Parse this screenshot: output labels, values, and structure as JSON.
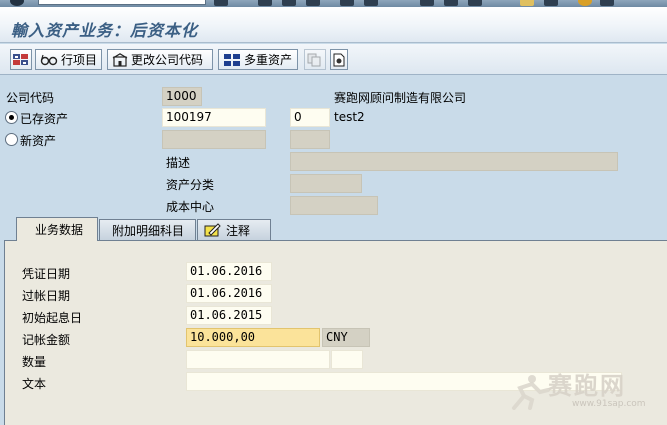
{
  "window": {
    "title": "輸入资产业务：后资本化"
  },
  "toolbar": {
    "line_items_label": "行项目",
    "change_company_label": "更改公司代码",
    "multiple_assets_label": "多重资产"
  },
  "header": {
    "company_code_label": "公司代码",
    "company_code_value": "1000",
    "company_name": "赛跑网顾问制造有限公司",
    "existing_asset_label": "已存资产",
    "asset_number": "100197",
    "sub_number": "0",
    "asset_name": "test2",
    "new_asset_label": "新资产",
    "description_label": "描述",
    "asset_class_label": "资产分类",
    "cost_center_label": "成本中心"
  },
  "tabs": [
    {
      "label": "业务数据"
    },
    {
      "label": "附加明细科目"
    },
    {
      "label": "注释"
    }
  ],
  "transaction": {
    "document_date_label": "凭证日期",
    "document_date": "01.06.2016",
    "posting_date_label": "过帐日期",
    "posting_date": "01.06.2016",
    "value_date_label": "初始起息日",
    "value_date": "01.06.2015",
    "amount_label": "记帐金额",
    "amount": "10.000,00",
    "currency": "CNY",
    "quantity_label": "数量",
    "quantity": "",
    "text_label": "文本",
    "text": ""
  },
  "watermark": {
    "text": "赛跑网",
    "url": "www.91sap.com"
  },
  "colors": {
    "background": "#c9dbe9",
    "title_text": "#3b5f84",
    "readonly_field": "#d4d1c4",
    "input_field": "#fefdf1",
    "focused_field": "#fbe39a",
    "tab_panel": "#ebe9df"
  }
}
